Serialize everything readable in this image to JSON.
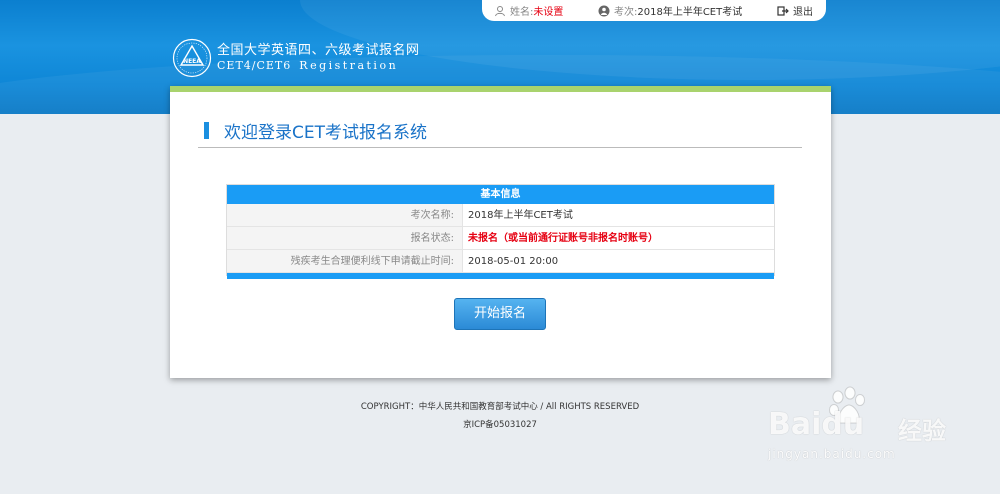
{
  "userbar": {
    "name_label": "姓名:",
    "name_value": "未设置",
    "exam_label": "考次:",
    "exam_value": "2018年上半年CET考试",
    "logout_label": "退出"
  },
  "logo": {
    "title_cn": "全国大学英语四、六级考试报名网",
    "title_en": "CET4/CET6",
    "title_en2": "Registration",
    "emblem_text": "NEEA"
  },
  "card": {
    "title": "欢迎登录CET考试报名系统"
  },
  "info": {
    "header": "基本信息",
    "rows": [
      {
        "key": "考次名称:",
        "value": "2018年上半年CET考试"
      },
      {
        "key": "报名状态:",
        "value": "未报名（或当前通行证账号非报名时账号）"
      },
      {
        "key": "残疾考生合理便利线下申请截止时间:",
        "value": "2018-05-01 20:00"
      }
    ]
  },
  "start_button": "开始报名",
  "footer": {
    "copyright": "COPYRIGHT：中华人民共和国教育部考试中心 / All RIGHTS RESERVED",
    "icp": "京ICP备05031027"
  },
  "watermark": {
    "brand": "Bai",
    "brand2": "du",
    "jingyan": "经验",
    "url": "jingyan.baidu.com"
  },
  "colors": {
    "header_blue": "#1a93e0",
    "accent_green": "#a9d36d",
    "status_red": "#e60012",
    "table_blue": "#1a9cf5"
  }
}
